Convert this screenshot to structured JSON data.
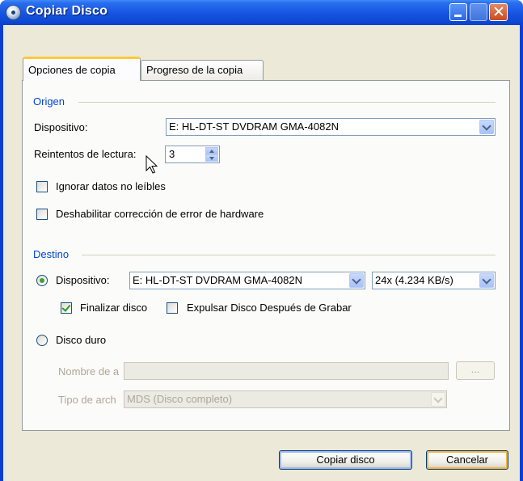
{
  "window": {
    "title": "Copiar Disco"
  },
  "tabs": [
    {
      "label": "Opciones de copia",
      "active": true
    },
    {
      "label": "Progreso de la copia",
      "active": false
    }
  ],
  "origen": {
    "group_label": "Origen",
    "device_label": "Dispositivo:",
    "device_value": "E: HL-DT-ST DVDRAM GMA-4082N",
    "retries_label": "Reintentos de lectura:",
    "retries_value": "3",
    "ignore_label": "Ignorar datos no leíbles",
    "ignore_checked": false,
    "disable_ecc_label": "Deshabilitar corrección de error de hardware",
    "disable_ecc_checked": false
  },
  "destino": {
    "group_label": "Destino",
    "device_radio_label": "Dispositivo:",
    "device_radio_selected": true,
    "device_value": "E: HL-DT-ST DVDRAM GMA-4082N",
    "speed_value": "24x (4.234 KB/s)",
    "finalize_label": "Finalizar disco",
    "finalize_checked": true,
    "eject_label": "Expulsar Disco Después de Grabar",
    "eject_checked": false,
    "harddisk_label": "Disco duro",
    "harddisk_selected": false,
    "filename_label": "Nombre de a",
    "filename_value": "",
    "browse_label": "...",
    "filetype_label": "Tipo de arch",
    "filetype_value": "MDS (Disco completo)"
  },
  "buttons": {
    "copy": "Copiar disco",
    "cancel": "Cancelar"
  },
  "colors": {
    "titlebar": "#0a3fd1",
    "group_label": "#0046d5",
    "dialog_bg": "#ece9d8",
    "tab_accent": "#ffc83c"
  }
}
